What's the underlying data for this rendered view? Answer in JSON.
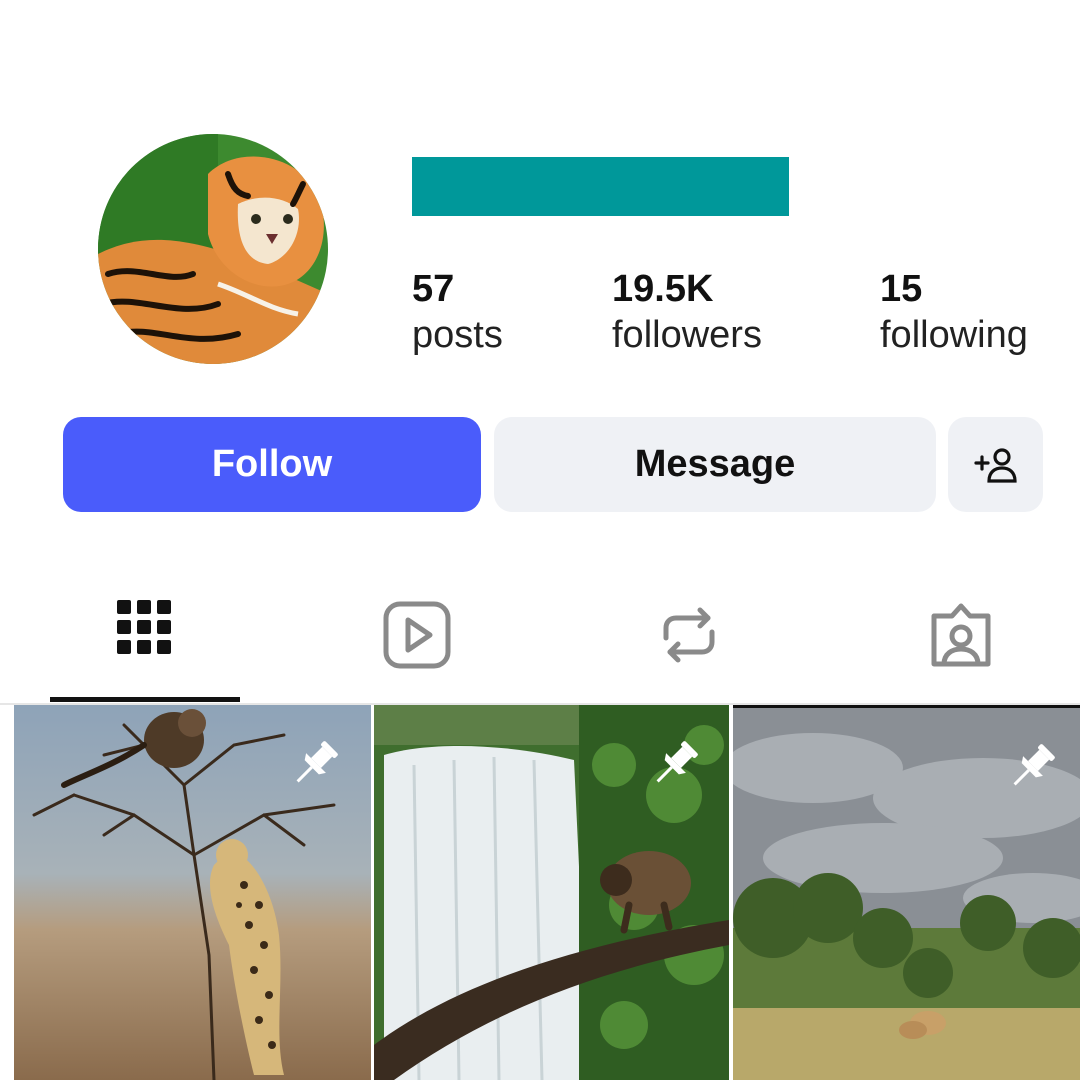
{
  "profile": {
    "avatar_icon": "tiger-avatar",
    "name_redacted_color": "#00989a"
  },
  "stats": {
    "posts": {
      "value": "57",
      "label": "posts"
    },
    "followers": {
      "value": "19.5K",
      "label": "followers"
    },
    "following": {
      "value": "15",
      "label": "following"
    }
  },
  "actions": {
    "follow_label": "Follow",
    "message_label": "Message",
    "add_user_icon": "add-person-icon",
    "follow_color": "#4a5cfb"
  },
  "tabs": [
    {
      "icon": "grid-icon",
      "selected": true
    },
    {
      "icon": "reels-icon",
      "selected": false
    },
    {
      "icon": "repost-icon",
      "selected": false
    },
    {
      "icon": "tagged-icon",
      "selected": false
    }
  ],
  "posts": [
    {
      "subject": "leopard-and-monkey-on-tree",
      "pinned": true,
      "pin_icon": "pin-icon"
    },
    {
      "subject": "monkey-by-waterfall",
      "pinned": true,
      "pin_icon": "pin-icon"
    },
    {
      "subject": "savanna-lions",
      "pinned": true,
      "pin_icon": "pin-icon"
    }
  ]
}
